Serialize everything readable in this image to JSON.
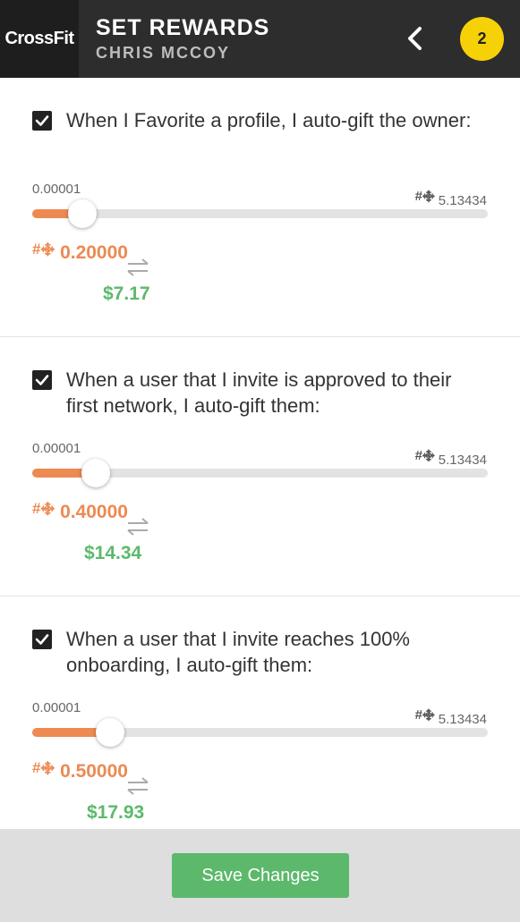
{
  "header": {
    "logo_text": "CrossFit",
    "title": "SET REWARDS",
    "subtitle": "CHRIS MCCOY",
    "badge_count": "2"
  },
  "currency_symbol": "#࿇",
  "colors": {
    "header_bg": "#2d2d2d",
    "accent_orange": "#ec8a52",
    "accent_green": "#5cb96b",
    "badge_yellow": "#f7d108"
  },
  "rewards": [
    {
      "checked": true,
      "label": "When I Favorite a profile, I auto-gift the owner:",
      "min": "0.00001",
      "max": "5.13434",
      "value": "0.20000",
      "usd": "$7.17",
      "slider_fraction": 0.11
    },
    {
      "checked": true,
      "label": "When a user that I invite is approved to their first network, I auto-gift them:",
      "min": "0.00001",
      "max": "5.13434",
      "value": "0.40000",
      "usd": "$14.34",
      "slider_fraction": 0.14
    },
    {
      "checked": true,
      "label": "When a user that I invite reaches 100% onboarding, I auto-gift them:",
      "min": "0.00001",
      "max": "5.13434",
      "value": "0.50000",
      "usd": "$17.93",
      "slider_fraction": 0.17
    }
  ],
  "footer": {
    "save_label": "Save Changes"
  }
}
